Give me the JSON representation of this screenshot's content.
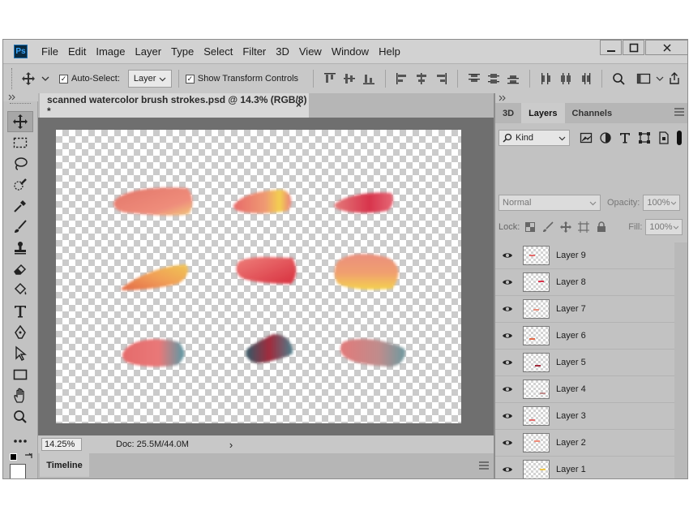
{
  "app": {
    "logo": "Ps"
  },
  "menu": [
    "File",
    "Edit",
    "Image",
    "Layer",
    "Type",
    "Select",
    "Filter",
    "3D",
    "View",
    "Window",
    "Help"
  ],
  "options": {
    "auto_select_label": "Auto-Select:",
    "auto_select_checked": true,
    "auto_select_target": "Layer",
    "show_transform_label": "Show Transform Controls",
    "show_transform_checked": true
  },
  "document": {
    "tab_title": "scanned watercolor brush strokes.psd @ 14.3% (RGB/8) *",
    "close_glyph": "×",
    "zoom": "14.25%",
    "doc_size": "Doc: 25.5M/44.0M",
    "status_arrow": "›"
  },
  "timeline": {
    "label": "Timeline"
  },
  "panel": {
    "tabs": [
      "3D",
      "Layers",
      "Channels"
    ],
    "active_tab": "Layers",
    "filter_label": "Kind",
    "blend_mode": "Normal",
    "opacity_label": "Opacity:",
    "opacity_value": "100%",
    "lock_label": "Lock:",
    "fill_label": "Fill:",
    "fill_value": "100%",
    "layers": [
      "Layer 9",
      "Layer 8",
      "Layer 7",
      "Layer 6",
      "Layer 5",
      "Layer 4",
      "Layer 3",
      "Layer 2",
      "Layer 1"
    ]
  },
  "colors": {
    "accent_stroke_red": "#e85a5a",
    "accent_stroke_yellow": "#f2c94c",
    "accent_stroke_teal": "#4a8a93"
  }
}
